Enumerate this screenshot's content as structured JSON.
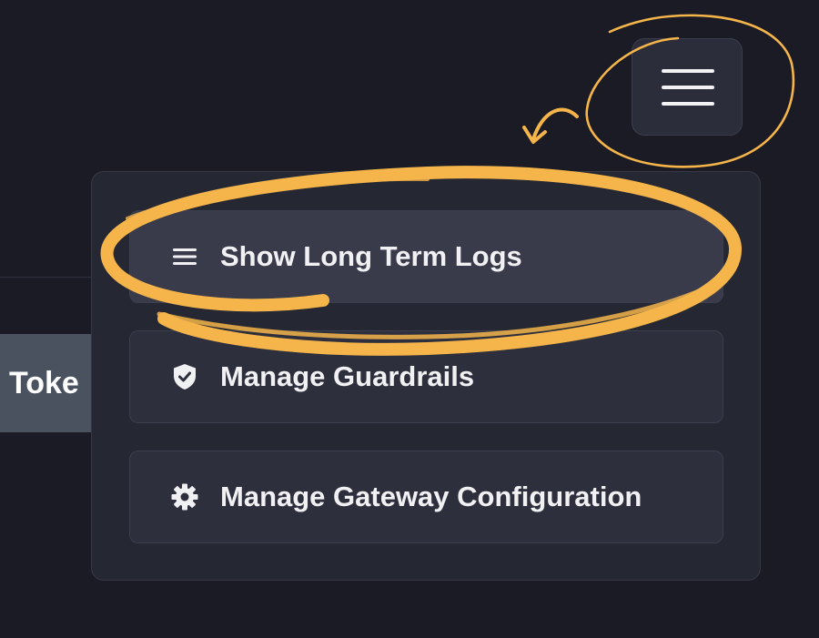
{
  "page": {
    "partial_tab_label": "Toke"
  },
  "menu_button": {
    "icon": "hamburger-icon"
  },
  "dropdown": {
    "items": [
      {
        "label": "Show Long Term Logs",
        "icon": "list-icon",
        "highlighted": true
      },
      {
        "label": "Manage Guardrails",
        "icon": "shield-check-icon",
        "highlighted": false
      },
      {
        "label": "Manage Gateway Configuration",
        "icon": "gear-icon",
        "highlighted": false
      }
    ]
  },
  "annotation": {
    "color": "#f5b54a"
  },
  "colors": {
    "background": "#1a1b25",
    "panel": "#252733",
    "item": "#2d2f3c",
    "item_active": "#393b4b",
    "text": "#f1f1f4",
    "tab": "#4a5260"
  }
}
